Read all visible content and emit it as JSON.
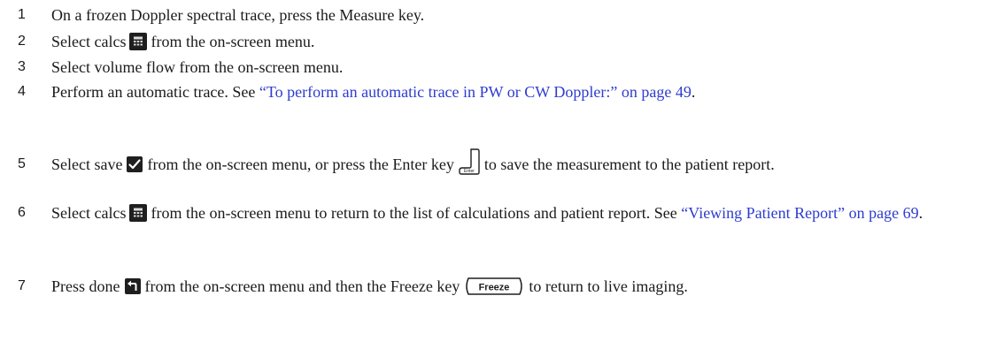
{
  "steps": [
    {
      "num": "1",
      "text": "On a frozen Doppler spectral trace, press the Measure key."
    },
    {
      "num": "2",
      "pre": "Select calcs",
      "icon": "calculator-icon",
      "post": "from the on-screen menu."
    },
    {
      "num": "3",
      "text": "Select volume flow from the on-screen menu."
    },
    {
      "num": "4",
      "pre": "Perform an automatic trace. See ",
      "link": "“To perform an automatic trace in PW or CW Doppler:” on page 49",
      "post": "."
    },
    {
      "num": "5",
      "pre": "Select save",
      "icon": "checkmark-icon",
      "mid": "from the on-screen menu, or press the Enter key",
      "icon2": "enter-key-icon",
      "post": "to save the measurement to the patient report."
    },
    {
      "num": "6",
      "pre": "Select calcs",
      "icon": "calculator-icon",
      "mid": "from the on-screen menu to return to the list of calculations and patient report. See ",
      "link": "“Viewing Patient Report” on page 69",
      "post": "."
    },
    {
      "num": "7",
      "pre": "Press done",
      "icon": "back-arrow-icon",
      "mid": "from the on-screen menu and then the Freeze key",
      "icon2": "freeze-key-icon",
      "post": "to return to live imaging."
    }
  ],
  "icons": {
    "enter_label": "Enter",
    "freeze_label": "Freeze"
  },
  "colors": {
    "text": "#1a1a1a",
    "link": "#2e3cd0",
    "icon_dark": "#1f1f1f"
  }
}
